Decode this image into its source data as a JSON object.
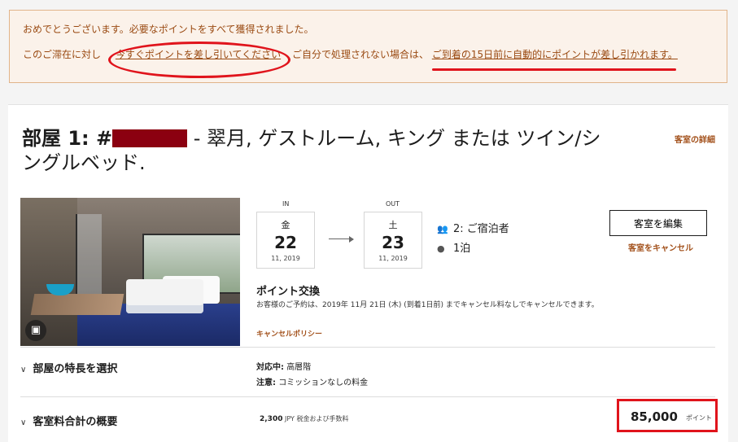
{
  "notice": {
    "line1": "おめでとうございます。必要なポイントをすべて獲得されました。",
    "line2_prefix": "このご滞在に対し",
    "deduct_now_link": "今すぐポイントを差し引いてください",
    "line2_middle": "ご自分で処理されない場合は、",
    "auto_deduct_text": "ご到着の15日前に自動的にポイントが差し引かれます。",
    "accent_color": "#9a4a12"
  },
  "room": {
    "title_prefix": "部屋  1:  #",
    "title_rest": " - 翠月, ゲストルーム, キング または ツイン/シングルベッド.",
    "details_link": "客室の詳細"
  },
  "dates": {
    "in_label": "IN",
    "in_dow": "金",
    "in_day": "22",
    "in_month_year": "11, 2019",
    "out_label": "OUT",
    "out_dow": "土",
    "out_day": "23",
    "out_month_year": "11, 2019"
  },
  "stay": {
    "guests": "2: ご宿泊者",
    "nights": "1泊",
    "guests_icon": "people-icon",
    "nights_icon": "moon-icon"
  },
  "actions": {
    "edit_button": "客室を編集",
    "cancel_link": "客室をキャンセル"
  },
  "points": {
    "title": "ポイント交換",
    "description": "お客様のご予約は、2019年 11月 21日 (木) (到着1日前) までキャンセル料なしでキャンセルできます。",
    "policy_link": "キャンセルポリシー"
  },
  "features": {
    "section_label": "部屋の特長を選択",
    "support_label": "対応中:",
    "support_value": "高層階",
    "note_label": "注意:",
    "note_value": "コミッションなしの料金"
  },
  "summary": {
    "section_label": "客室料合計の概要",
    "tax_amount": "2,300",
    "tax_text": "JPY 税金および手数料",
    "total_points": "85,000",
    "points_unit": "ポイント"
  },
  "colors": {
    "highlight_red": "#e0141c",
    "link_brown": "#a3521d",
    "redaction": "#8b0010"
  }
}
